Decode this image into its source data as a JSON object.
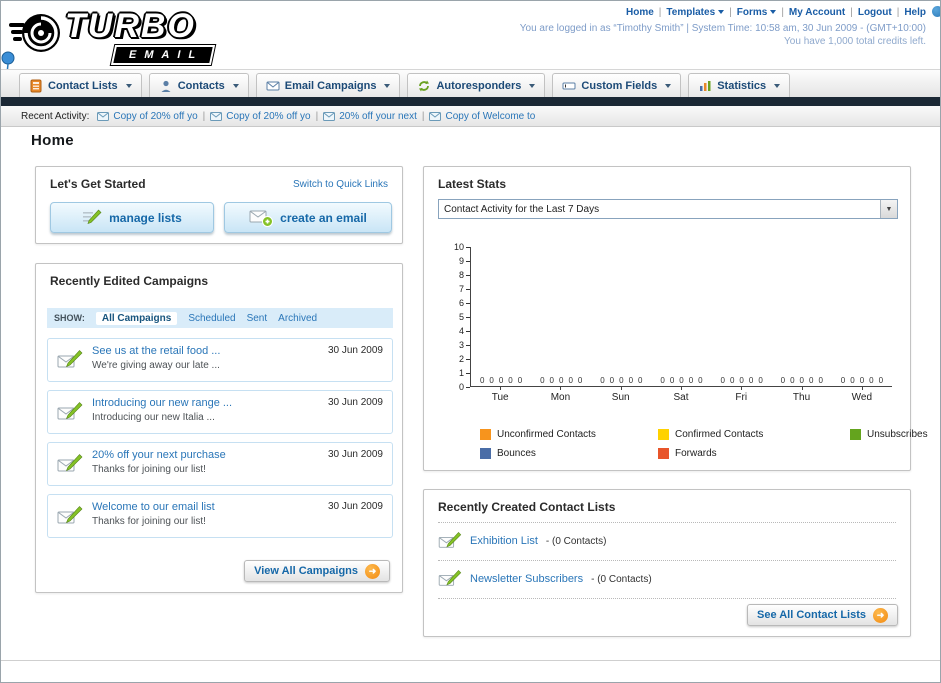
{
  "header": {
    "logo_text": "TURBO",
    "logo_badge": "EMAIL",
    "nav_links": [
      {
        "label": "Home",
        "dropdown": false
      },
      {
        "label": "Templates",
        "dropdown": true
      },
      {
        "label": "Forms",
        "dropdown": true
      },
      {
        "label": "My Account",
        "dropdown": false
      },
      {
        "label": "Logout",
        "dropdown": false
      },
      {
        "label": "Help",
        "dropdown": false
      }
    ],
    "login_info": "You are logged in as “Timothy Smith” | System Time: 10:58 am, 30 Jun 2009 - (GMT+10:00)",
    "credits_info": "You have 1,000 total credits left."
  },
  "nav": {
    "tabs": [
      {
        "label": "Contact Lists"
      },
      {
        "label": "Contacts"
      },
      {
        "label": "Email Campaigns"
      },
      {
        "label": "Autoresponders"
      },
      {
        "label": "Custom Fields"
      },
      {
        "label": "Statistics"
      }
    ]
  },
  "activity": {
    "label": "Recent Activity:",
    "items": [
      "Copy of 20% off yo",
      "Copy of 20% off yo",
      "20% off your next",
      "Copy of Welcome to"
    ]
  },
  "page": {
    "title": "Home"
  },
  "get_started": {
    "title": "Let's Get Started",
    "switch_link": "Switch to Quick Links",
    "manage_lists_label": "manage lists",
    "create_email_label": "create an email"
  },
  "campaigns": {
    "title": "Recently Edited Campaigns",
    "show_label": "SHOW:",
    "filters": [
      "All Campaigns",
      "Scheduled",
      "Sent",
      "Archived"
    ],
    "items": [
      {
        "title": "See us at the retail food ...",
        "subtitle": "We're giving away our late ...",
        "date": "30 Jun 2009"
      },
      {
        "title": "Introducing our new range ...",
        "subtitle": "Introducing our new Italia ...",
        "date": "30 Jun 2009"
      },
      {
        "title": "20% off your next purchase",
        "subtitle": "Thanks for joining our list!",
        "date": "30 Jun 2009"
      },
      {
        "title": "Welcome to our email list",
        "subtitle": "Thanks for joining our list!",
        "date": "30 Jun 2009"
      }
    ],
    "view_all_label": "View All Campaigns"
  },
  "stats": {
    "title": "Latest Stats",
    "dropdown_value": "Contact Activity for the Last 7 Days",
    "chart_data": {
      "type": "bar",
      "title": "Contact Activity for the Last 7 Days",
      "categories": [
        "Tue",
        "Mon",
        "Sun",
        "Sat",
        "Fri",
        "Thu",
        "Wed"
      ],
      "series": [
        {
          "name": "Unconfirmed Contacts",
          "color": "#f7941d",
          "values": [
            0,
            0,
            0,
            0,
            0,
            0,
            0
          ]
        },
        {
          "name": "Confirmed Contacts",
          "color": "#ffd200",
          "values": [
            0,
            0,
            0,
            0,
            0,
            0,
            0
          ]
        },
        {
          "name": "Unsubscribes",
          "color": "#64a41e",
          "values": [
            0,
            0,
            0,
            0,
            0,
            0,
            0
          ]
        },
        {
          "name": "Bounces",
          "color": "#4a6da7",
          "values": [
            0,
            0,
            0,
            0,
            0,
            0,
            0
          ]
        },
        {
          "name": "Forwards",
          "color": "#e8552a",
          "values": [
            0,
            0,
            0,
            0,
            0,
            0,
            0
          ]
        }
      ],
      "ylim": [
        0,
        10
      ],
      "yticks": [
        0,
        1,
        2,
        3,
        4,
        5,
        6,
        7,
        8,
        9,
        10
      ],
      "grid": false,
      "legend_position": "bottom",
      "data_labels": true
    }
  },
  "contact_lists": {
    "title": "Recently Created Contact Lists",
    "items": [
      {
        "name": "Exhibition List",
        "detail": "- (0 Contacts)"
      },
      {
        "name": "Newsletter Subscribers",
        "detail": "- (0 Contacts)"
      }
    ],
    "see_all_label": "See All Contact Lists"
  }
}
